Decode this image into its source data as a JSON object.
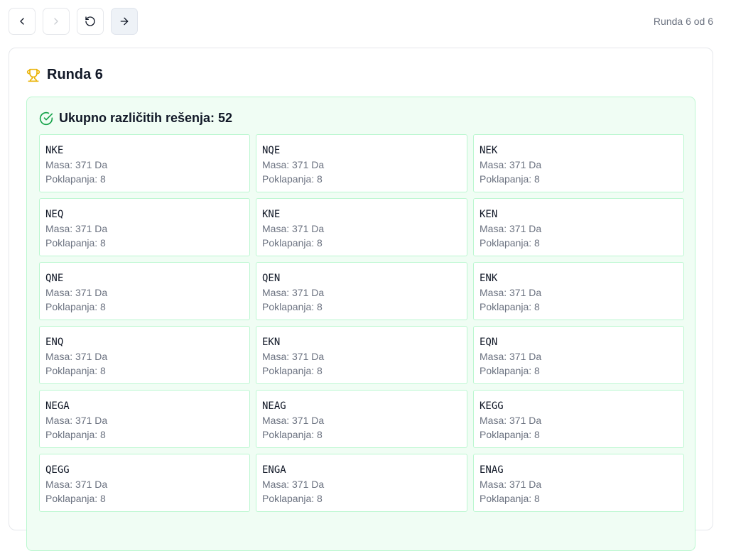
{
  "toolbar": {
    "round_counter": "Runda 6 od 6"
  },
  "round": {
    "title": "Runda 6",
    "summary": "Ukupno različitih rešenja: 52"
  },
  "labels": {
    "mass_prefix": "Masa:",
    "matches_prefix": "Poklapanja:"
  },
  "solutions": [
    {
      "sequence": "NKE",
      "mass": "Masa: 371 Da",
      "matches": "Poklapanja: 8"
    },
    {
      "sequence": "NQE",
      "mass": "Masa: 371 Da",
      "matches": "Poklapanja: 8"
    },
    {
      "sequence": "NEK",
      "mass": "Masa: 371 Da",
      "matches": "Poklapanja: 8"
    },
    {
      "sequence": "NEQ",
      "mass": "Masa: 371 Da",
      "matches": "Poklapanja: 8"
    },
    {
      "sequence": "KNE",
      "mass": "Masa: 371 Da",
      "matches": "Poklapanja: 8"
    },
    {
      "sequence": "KEN",
      "mass": "Masa: 371 Da",
      "matches": "Poklapanja: 8"
    },
    {
      "sequence": "QNE",
      "mass": "Masa: 371 Da",
      "matches": "Poklapanja: 8"
    },
    {
      "sequence": "QEN",
      "mass": "Masa: 371 Da",
      "matches": "Poklapanja: 8"
    },
    {
      "sequence": "ENK",
      "mass": "Masa: 371 Da",
      "matches": "Poklapanja: 8"
    },
    {
      "sequence": "ENQ",
      "mass": "Masa: 371 Da",
      "matches": "Poklapanja: 8"
    },
    {
      "sequence": "EKN",
      "mass": "Masa: 371 Da",
      "matches": "Poklapanja: 8"
    },
    {
      "sequence": "EQN",
      "mass": "Masa: 371 Da",
      "matches": "Poklapanja: 8"
    },
    {
      "sequence": "NEGA",
      "mass": "Masa: 371 Da",
      "matches": "Poklapanja: 8"
    },
    {
      "sequence": "NEAG",
      "mass": "Masa: 371 Da",
      "matches": "Poklapanja: 8"
    },
    {
      "sequence": "KEGG",
      "mass": "Masa: 371 Da",
      "matches": "Poklapanja: 8"
    },
    {
      "sequence": "QEGG",
      "mass": "Masa: 371 Da",
      "matches": "Poklapanja: 8"
    },
    {
      "sequence": "ENGA",
      "mass": "Masa: 371 Da",
      "matches": "Poklapanja: 8"
    },
    {
      "sequence": "ENAG",
      "mass": "Masa: 371 Da",
      "matches": "Poklapanja: 8"
    }
  ],
  "colors": {
    "accent_green": "#16a34a",
    "trophy_gold": "#eab308",
    "panel_bg": "#f0fdf4"
  },
  "icons": {
    "prev": "chevron-left-icon",
    "next": "chevron-right-icon",
    "reset": "rotate-ccw-icon",
    "advance": "arrow-right-icon",
    "trophy": "trophy-icon",
    "check": "check-circle-icon"
  }
}
